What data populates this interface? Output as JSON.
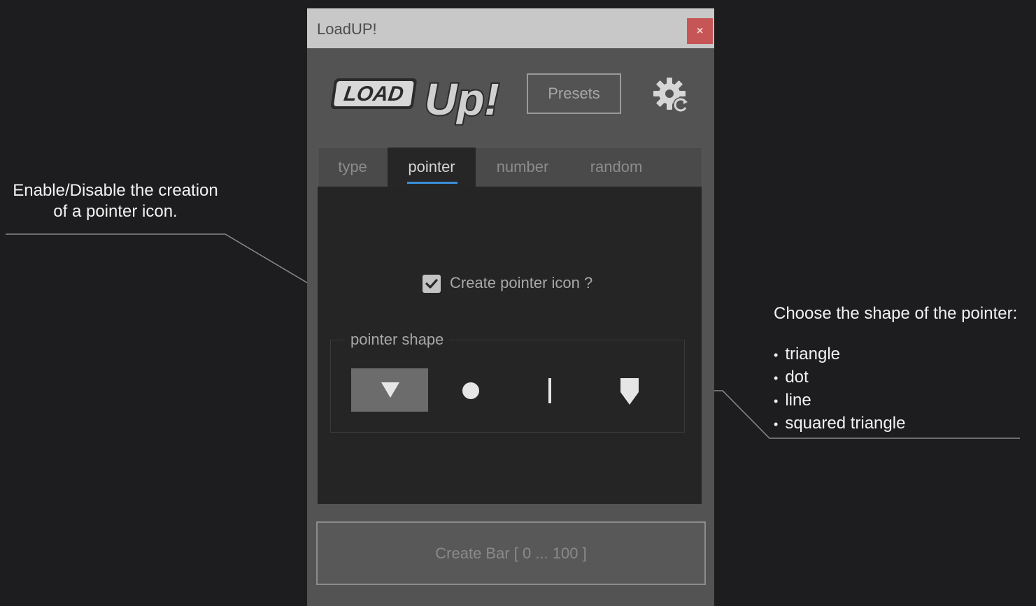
{
  "window": {
    "title": "LoadUP!",
    "close_glyph": "×"
  },
  "header": {
    "logo_text": "LOADUp!",
    "presets_label": "Presets",
    "settings_icon": "gear-refresh-icon"
  },
  "tabs": [
    {
      "label": "type",
      "active": false
    },
    {
      "label": "pointer",
      "active": true
    },
    {
      "label": "number",
      "active": false
    },
    {
      "label": "random",
      "active": false
    }
  ],
  "pointer_tab": {
    "checkbox_label": "Create pointer icon ?",
    "checkbox_checked": true,
    "group_label": "pointer shape",
    "shapes": [
      {
        "icon": "triangle-icon",
        "selected": true
      },
      {
        "icon": "dot-icon",
        "selected": false
      },
      {
        "icon": "line-icon",
        "selected": false
      },
      {
        "icon": "squared-triangle-icon",
        "selected": false
      }
    ]
  },
  "footer": {
    "create_label": "Create Bar [ 0 ... 100 ]"
  },
  "annotations": {
    "left_line1": "Enable/Disable the creation",
    "left_line2": "of a pointer icon.",
    "right_title": "Choose the shape of the pointer:",
    "right_items": [
      "triangle",
      "dot",
      "line",
      "squared triangle"
    ]
  },
  "colors": {
    "accent": "#3b8fd8",
    "close": "#c65656"
  }
}
